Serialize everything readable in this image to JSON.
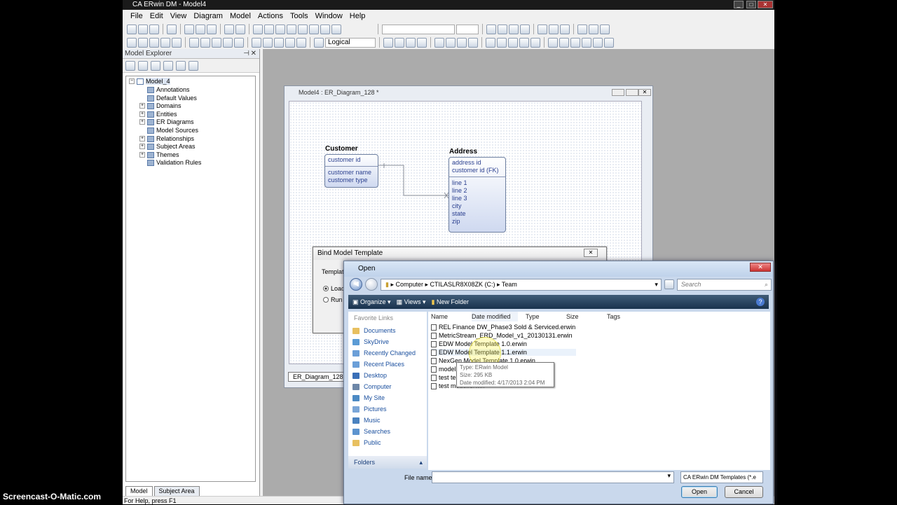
{
  "app": {
    "title": "CA ERwin DM - Model4",
    "menu": [
      "File",
      "Edit",
      "View",
      "Diagram",
      "Model",
      "Actions",
      "Tools",
      "Window",
      "Help"
    ],
    "toolbar_dropdown": "Logical",
    "status": "For Help, press F1"
  },
  "explorer": {
    "title": "Model Explorer",
    "root": "Model_4",
    "items": [
      "Annotations",
      "Default Values",
      "Domains",
      "Entities",
      "ER Diagrams",
      "Model Sources",
      "Relationships",
      "Subject Areas",
      "Themes",
      "Validation Rules"
    ],
    "tabs": [
      "Model",
      "Subject Area"
    ]
  },
  "diagram": {
    "title": "Model4 : ER_Diagram_128 *",
    "tab": "ER_Diagram_128",
    "customer": {
      "name": "Customer",
      "key": "customer id",
      "attrs": [
        "customer name",
        "customer type"
      ]
    },
    "address": {
      "name": "Address",
      "keys": [
        "address id",
        "customer id (FK)"
      ],
      "attrs": [
        "line 1",
        "line 2",
        "line 3",
        "city",
        "state",
        "zip"
      ]
    }
  },
  "bind": {
    "title": "Bind Model Template",
    "templates_label": "Template",
    "options": [
      "Load",
      "Run t"
    ]
  },
  "open": {
    "title": "Open",
    "path": [
      "Computer",
      "CTILASLR8X08ZK (C:)",
      "Team"
    ],
    "search_placeholder": "Search",
    "commands": [
      "Organize",
      "Views",
      "New Folder"
    ],
    "favorites_header": "Favorite Links",
    "favorites": [
      "Documents",
      "SkyDrive",
      "Recently Changed",
      "Recent Places",
      "Desktop",
      "Computer",
      "My Site",
      "Pictures",
      "Music",
      "Searches",
      "Public"
    ],
    "folders_label": "Folders",
    "columns": [
      "Name",
      "Date modified",
      "Type",
      "Size",
      "Tags"
    ],
    "files": [
      "REL Finance DW_Phase3 Sold & Serviced.erwin",
      "MetricStream_ERD_Model_v1_20130131.erwin",
      "EDW Model Template 1.0.erwin",
      "EDW Model Template 1.1.erwin",
      "NexGen Model Template 1.0.erwin",
      "model",
      "test ter",
      "test model.erwin"
    ],
    "tooltip": {
      "type": "Type: ERwin Model",
      "size": "Size: 295 KB",
      "date": "Date modified: 4/17/2013 2:04 PM"
    },
    "filename_label": "File name:",
    "filetype": "CA ERwin DM Templates (*.e",
    "open_btn": "Open",
    "cancel_btn": "Cancel"
  },
  "watermark": "Screencast-O-Matic.com"
}
